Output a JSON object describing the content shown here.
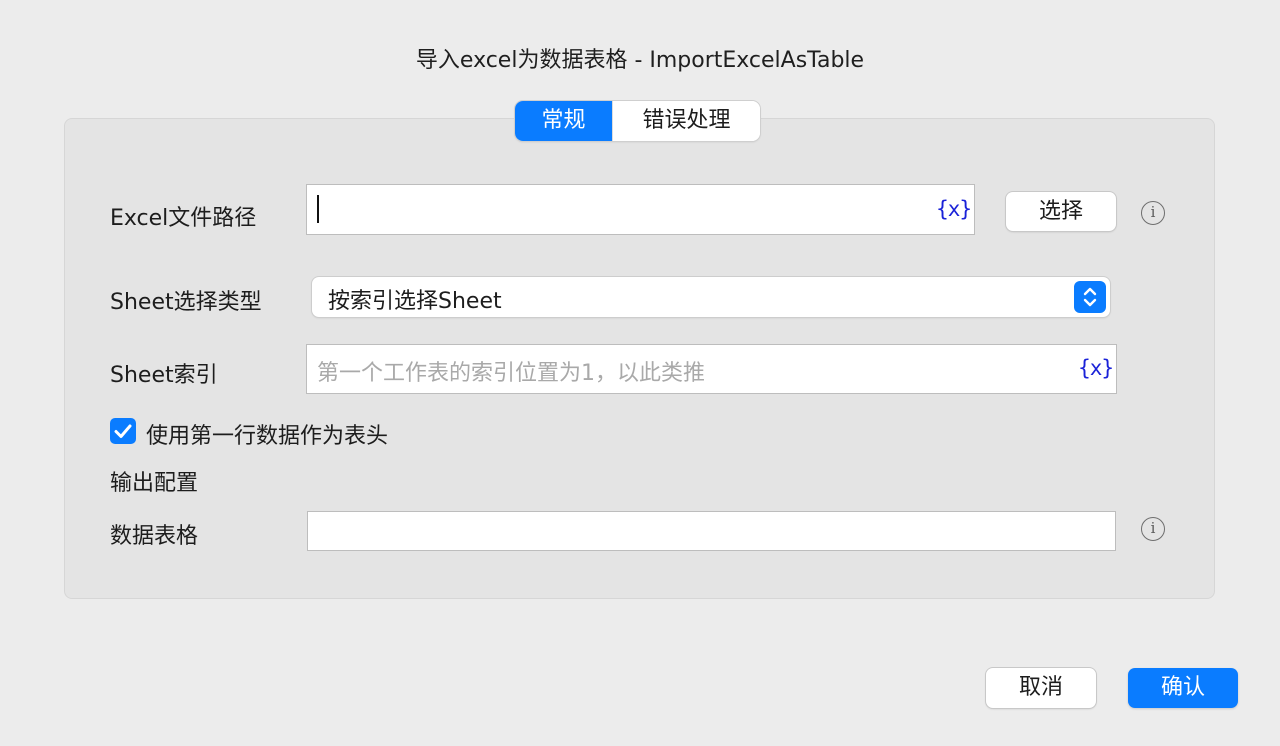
{
  "dialog": {
    "title": "导入excel为数据表格 - ImportExcelAsTable"
  },
  "tabs": [
    {
      "label": "常规",
      "active": true
    },
    {
      "label": "错误处理",
      "active": false
    }
  ],
  "form": {
    "excel_path": {
      "label": "Excel文件路径",
      "value": "",
      "var_label": "{x}",
      "choose_label": "选择"
    },
    "sheet_type": {
      "label": "Sheet选择类型",
      "selected": "按索引选择Sheet"
    },
    "sheet_index": {
      "label": "Sheet索引",
      "placeholder": "第一个工作表的索引位置为1，以此类推",
      "var_label": "{x}"
    },
    "header_checkbox": {
      "label": "使用第一行数据作为表头",
      "checked": true
    },
    "output_section": {
      "label": "输出配置"
    },
    "data_table": {
      "label": "数据表格",
      "value": ""
    }
  },
  "footer": {
    "cancel_label": "取消",
    "confirm_label": "确认"
  },
  "colors": {
    "accent": "#0a7cff",
    "variable": "#1a22d8"
  },
  "icons": {
    "info": "info-icon",
    "stepper": "chevron-up-down-icon",
    "check": "checkmark-icon"
  }
}
